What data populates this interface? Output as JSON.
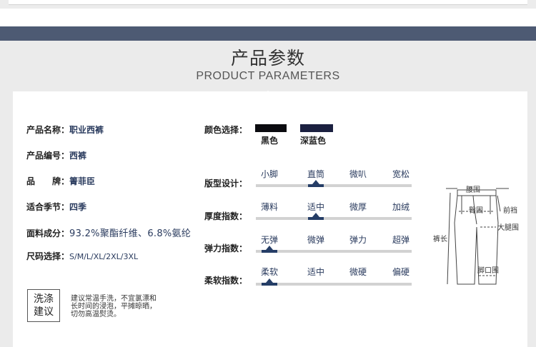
{
  "header": {
    "title_cn": "产品参数",
    "title_en": "PRODUCT PARAMETERS"
  },
  "info": [
    {
      "label": "产品名称：",
      "value": "职业西裤"
    },
    {
      "label": "产品编号：",
      "value": "西裤"
    },
    {
      "label": "品　　牌：",
      "value": "箐菲臣"
    },
    {
      "label": "适合季节：",
      "value": "四季"
    },
    {
      "label": "面料成分：",
      "value": "93.2%聚酯纤维、6.8%氨纶"
    },
    {
      "label": "尺码选择：",
      "value": "S/M/L/XL/2XL/3XL"
    }
  ],
  "wash": {
    "badge_line1": "洗涤",
    "badge_line2": "建议",
    "text_line1": "建议常温手洗，不宜氯漂和",
    "text_line2": "长时间的浸泡，平摊晾晒，",
    "text_line3": "切勿高温熨烫。"
  },
  "colors": {
    "label": "颜色选择：",
    "items": [
      {
        "name": "黑色",
        "hex": "#0b0b10"
      },
      {
        "name": "深蓝色",
        "hex": "#1b2040"
      }
    ]
  },
  "scales": [
    {
      "label": "版型设计：",
      "options": [
        "小脚",
        "直筒",
        "微叭",
        "宽松"
      ],
      "selected_index": 1
    },
    {
      "label": "厚度指数：",
      "options": [
        "薄料",
        "适中",
        "微厚",
        "加绒"
      ],
      "selected_index": 1
    },
    {
      "label": "弹力指数：",
      "options": [
        "无弹",
        "微弹",
        "弹力",
        "超弹"
      ],
      "selected_index": 0
    },
    {
      "label": "柔软指数：",
      "options": [
        "柔软",
        "适中",
        "微硬",
        "偏硬"
      ],
      "selected_index": 0
    }
  ],
  "diagram": {
    "waist": "腰围",
    "hip": "臀围",
    "front_rise": "前裆",
    "thigh": "大腿围",
    "length": "裤长",
    "hem": "脚口围"
  },
  "accent_color": "#253d66"
}
